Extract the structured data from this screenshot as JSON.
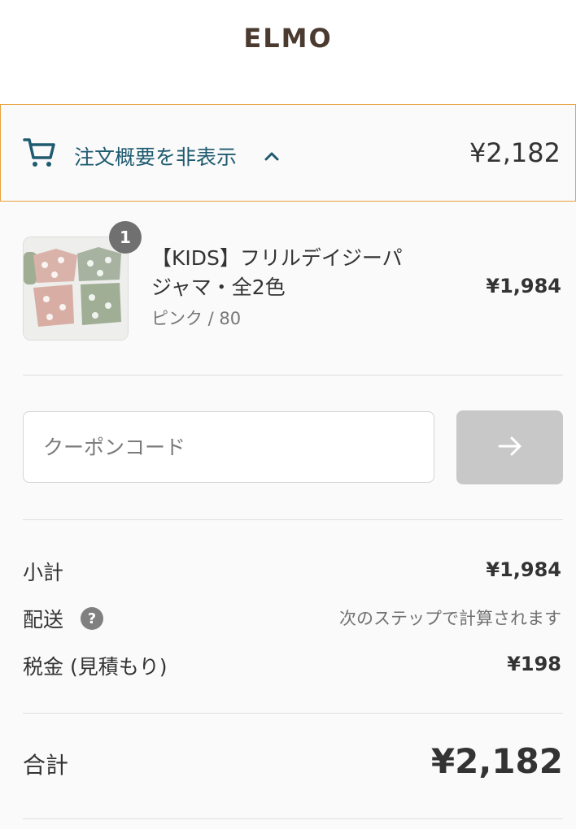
{
  "header": {
    "logo": "ELMO"
  },
  "order_summary_toggle": {
    "label": "注文概要を非表示",
    "total": "¥2,182",
    "icon": "cart-icon",
    "chevron_icon": "chevron-up-icon"
  },
  "line_items": [
    {
      "title_line1": "【KIDS】フリルデイジーパ",
      "title_line2": "ジャマ・全2色",
      "variant": "ピンク / 80",
      "quantity": "1",
      "price": "¥1,984"
    }
  ],
  "coupon": {
    "placeholder": "クーポンコード",
    "value": "",
    "submit_icon": "arrow-right-icon"
  },
  "totals": {
    "subtotal_label": "小計",
    "subtotal_value": "¥1,984",
    "shipping_label": "配送",
    "shipping_help_icon": "question-icon",
    "shipping_value": "次のステップで計算されます",
    "tax_label": "税金 (見積もり)",
    "tax_value": "¥198",
    "total_label": "合計",
    "total_value": "¥2,182"
  },
  "colors": {
    "accent_border": "#e6a23c",
    "link_text": "#1f5b70",
    "logo": "#4a3a30",
    "apply_button_disabled": "#c8c8c8"
  }
}
